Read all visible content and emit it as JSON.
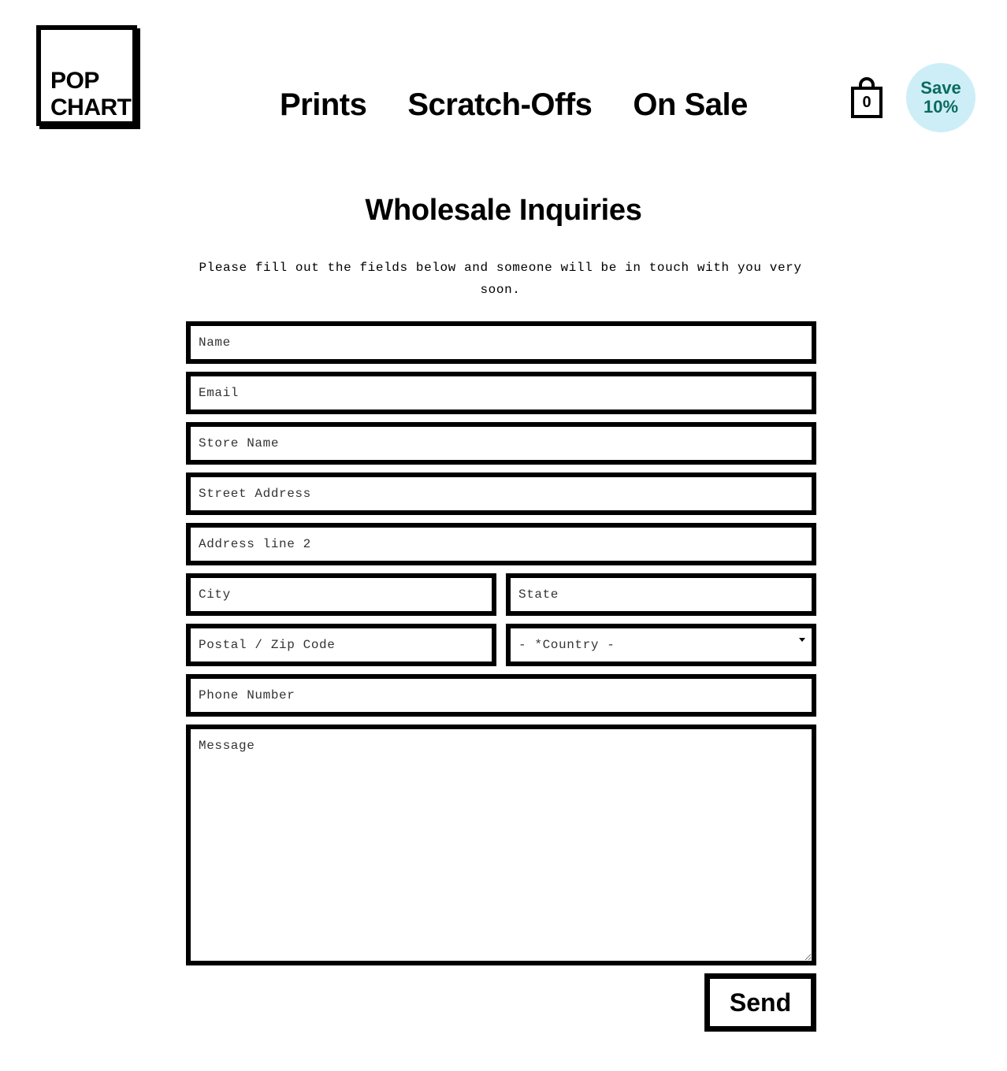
{
  "brand": {
    "logo_line1": "POP",
    "logo_line2": "CHART"
  },
  "nav": {
    "items": [
      {
        "label": "Prints"
      },
      {
        "label": "Scratch-Offs"
      },
      {
        "label": "On Sale"
      }
    ]
  },
  "cart": {
    "icon": "shopping-bag-icon",
    "count": "0"
  },
  "promo": {
    "line1": "Save",
    "line2": "10%",
    "background": "#cdeef6",
    "text_color": "#0b6b5e"
  },
  "page": {
    "title": "Wholesale Inquiries",
    "intro": "Please fill out the fields below and someone will be in touch with you very soon."
  },
  "form": {
    "name_placeholder": "Name",
    "email_placeholder": "Email",
    "store_placeholder": "Store Name",
    "street_placeholder": "Street Address",
    "address2_placeholder": "Address line 2",
    "city_placeholder": "City",
    "state_placeholder": "State",
    "zip_placeholder": "Postal / Zip Code",
    "country_selected": "- *Country -",
    "phone_placeholder": "Phone Number",
    "message_placeholder": "Message",
    "send_label": "Send"
  }
}
